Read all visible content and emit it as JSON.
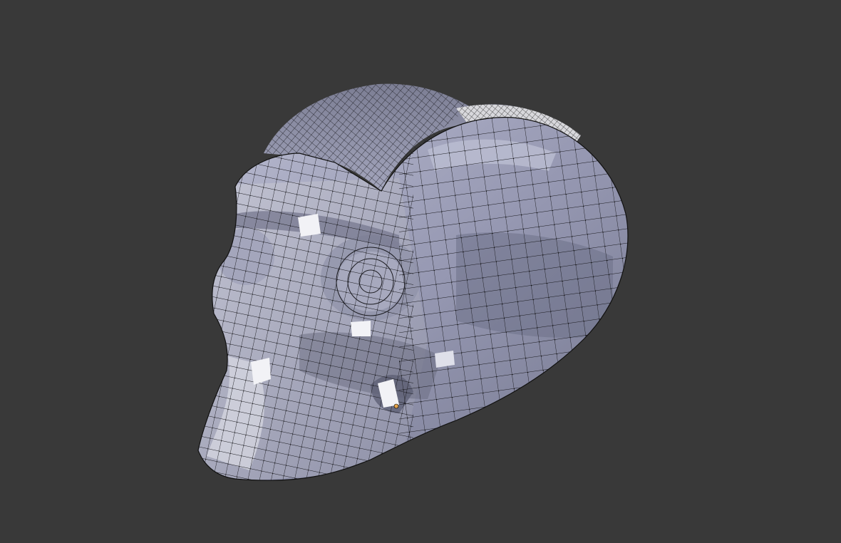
{
  "viewport": {
    "mode": "edit-mode",
    "shading": "solid",
    "background_color": "#393939",
    "object_name": "",
    "selection": {
      "active_vertex_count": 1
    }
  },
  "colors": {
    "mesh_base": "#9a9cb6",
    "mesh_light": "#c4c6d8",
    "mesh_shadow": "#5f6172",
    "wire": "#111111",
    "vertex": "#000000",
    "selected_vertex": "#e3a24a",
    "highlight": "#f2f2f6"
  },
  "icons": {
    "mesh": "monkey-mesh-icon",
    "selected_vertex": "selected-vertex-icon"
  }
}
